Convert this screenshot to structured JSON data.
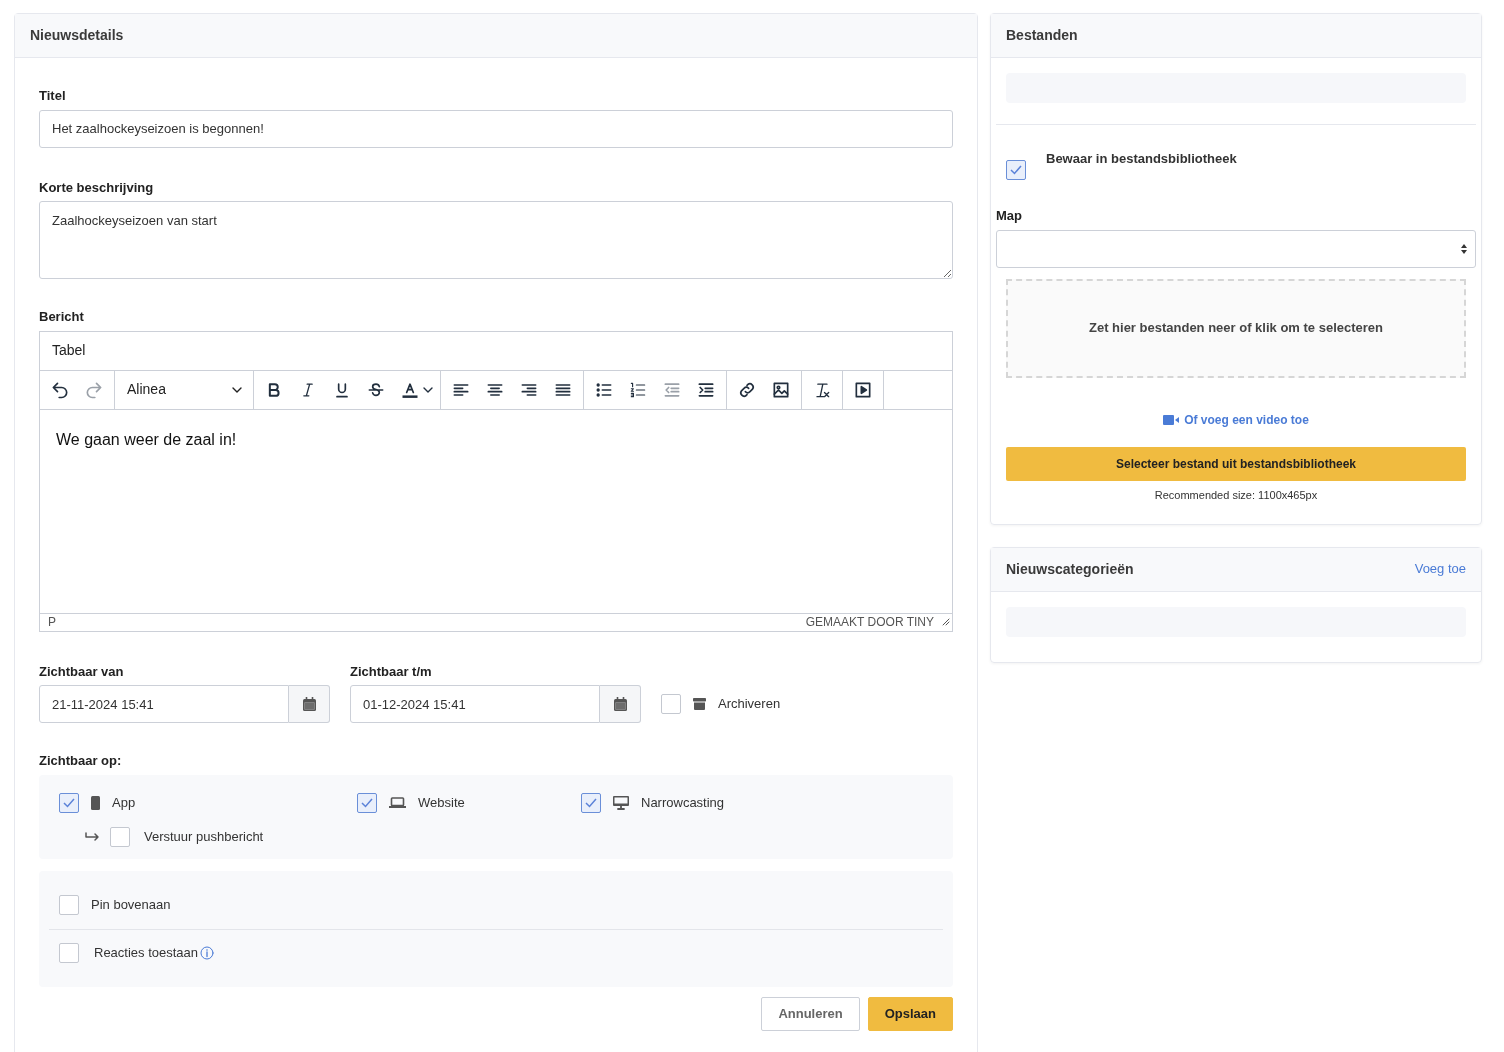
{
  "main_card": {
    "title": "Nieuwsdetails",
    "title_field": {
      "label": "Titel",
      "value": "Het zaalhockeyseizoen is begonnen!"
    },
    "description_field": {
      "label": "Korte beschrijving",
      "value": "Zaalhockeyseizoen van start"
    },
    "editor": {
      "label": "Bericht",
      "menu": [
        "Tabel"
      ],
      "toolbar_groups": [
        [
          {
            "kind": "button",
            "disabled": false
          },
          {
            "kind": "button",
            "disabled": true
          }
        ],
        [
          {
            "kind": "select",
            "label": "Alinea"
          }
        ],
        [
          {
            "kind": "button",
            "disabled": false
          },
          {
            "kind": "button",
            "disabled": false
          },
          {
            "kind": "button",
            "disabled": false
          },
          {
            "kind": "button",
            "disabled": false
          },
          {
            "kind": "split",
            "disabled": false
          }
        ],
        [
          {
            "kind": "button",
            "disabled": false
          },
          {
            "kind": "button",
            "disabled": false
          },
          {
            "kind": "button",
            "disabled": false
          },
          {
            "kind": "button",
            "disabled": false
          }
        ],
        [
          {
            "kind": "button",
            "disabled": false
          },
          {
            "kind": "button",
            "disabled": false
          },
          {
            "kind": "button",
            "disabled": true
          },
          {
            "kind": "button",
            "disabled": false
          }
        ],
        [
          {
            "kind": "button",
            "disabled": false
          },
          {
            "kind": "button",
            "disabled": false
          }
        ],
        [
          {
            "kind": "button",
            "disabled": false
          }
        ],
        [
          {
            "kind": "button",
            "disabled": false
          }
        ]
      ],
      "content": "We gaan weer de zaal in!",
      "status_path": "P",
      "branding": "GEMAAKT DOOR TINY"
    },
    "visible_from": {
      "label": "Zichtbaar van",
      "value": "21-11-2024 15:41"
    },
    "visible_until": {
      "label": "Zichtbaar t/m",
      "value": "01-12-2024 15:41"
    },
    "archive": {
      "label": "Archiveren",
      "checked": false
    },
    "visible_on": {
      "label": "Zichtbaar op:",
      "channels": [
        {
          "label": "App",
          "checked": true
        },
        {
          "label": "Website",
          "checked": true
        },
        {
          "label": "Narrowcasting",
          "checked": true
        }
      ],
      "push": {
        "label": "Verstuur pushbericht",
        "checked": false
      }
    },
    "options": [
      {
        "label": "Pin bovenaan",
        "checked": false,
        "info": false
      },
      {
        "label": "Reacties toestaan",
        "checked": false,
        "info": true
      }
    ],
    "buttons": [
      {
        "label": "Annuleren",
        "kind": "secondary"
      },
      {
        "label": "Opslaan",
        "kind": "primary"
      }
    ]
  },
  "files_card": {
    "title": "Bestanden",
    "save_to_library": {
      "label": "Bewaar in bestandsbibliotheek",
      "checked": true
    },
    "folder": {
      "label": "Map"
    },
    "dropzone": "Zet hier bestanden neer of klik om te selecteren",
    "video_link": "Of voeg een video toe",
    "library_button": "Selecteer bestand uit bestandsbibliotheek",
    "hint": "Recommended size: 1100x465px"
  },
  "categories_card": {
    "title": "Nieuwscategorieën",
    "add_link": "Voeg toe"
  }
}
